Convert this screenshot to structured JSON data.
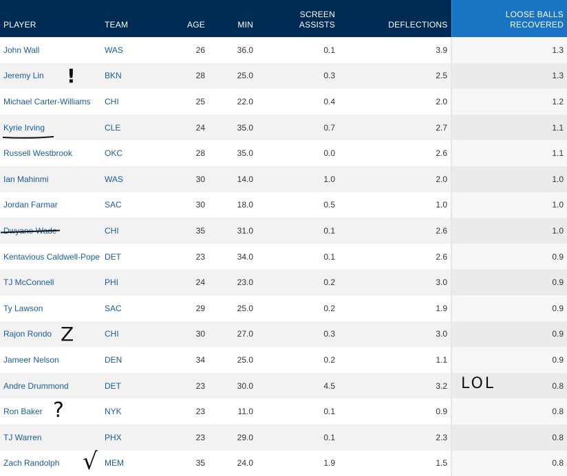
{
  "headers": {
    "player": "PLAYER",
    "team": "TEAM",
    "age": "AGE",
    "min": "MIN",
    "screen_assists_line1": "SCREEN",
    "screen_assists_line2": "ASSISTS",
    "deflections": "DEFLECTIONS",
    "loose_balls_line1": "LOOSE BALLS",
    "loose_balls_line2": "RECOVERED"
  },
  "rows": [
    {
      "player": "John Wall",
      "team": "WAS",
      "age": "26",
      "min": "36.0",
      "screen_assists": "0.1",
      "deflections": "3.9",
      "loose_balls": "1.3"
    },
    {
      "player": "Jeremy Lin",
      "team": "BKN",
      "age": "28",
      "min": "25.0",
      "screen_assists": "0.3",
      "deflections": "2.5",
      "loose_balls": "1.3"
    },
    {
      "player": "Michael Carter-Williams",
      "team": "CHI",
      "age": "25",
      "min": "22.0",
      "screen_assists": "0.4",
      "deflections": "2.0",
      "loose_balls": "1.2"
    },
    {
      "player": "Kyrie Irving",
      "team": "CLE",
      "age": "24",
      "min": "35.0",
      "screen_assists": "0.7",
      "deflections": "2.7",
      "loose_balls": "1.1"
    },
    {
      "player": "Russell Westbrook",
      "team": "OKC",
      "age": "28",
      "min": "35.0",
      "screen_assists": "0.0",
      "deflections": "2.6",
      "loose_balls": "1.1"
    },
    {
      "player": "Ian Mahinmi",
      "team": "WAS",
      "age": "30",
      "min": "14.0",
      "screen_assists": "1.0",
      "deflections": "2.0",
      "loose_balls": "1.0"
    },
    {
      "player": "Jordan Farmar",
      "team": "SAC",
      "age": "30",
      "min": "18.0",
      "screen_assists": "0.5",
      "deflections": "1.0",
      "loose_balls": "1.0"
    },
    {
      "player": "Dwyane Wade",
      "team": "CHI",
      "age": "35",
      "min": "31.0",
      "screen_assists": "0.1",
      "deflections": "2.6",
      "loose_balls": "1.0"
    },
    {
      "player": "Kentavious Caldwell-Pope",
      "team": "DET",
      "age": "23",
      "min": "34.0",
      "screen_assists": "0.1",
      "deflections": "2.6",
      "loose_balls": "0.9"
    },
    {
      "player": "TJ McConnell",
      "team": "PHI",
      "age": "24",
      "min": "23.0",
      "screen_assists": "0.2",
      "deflections": "3.0",
      "loose_balls": "0.9"
    },
    {
      "player": "Ty Lawson",
      "team": "SAC",
      "age": "29",
      "min": "25.0",
      "screen_assists": "0.2",
      "deflections": "1.9",
      "loose_balls": "0.9"
    },
    {
      "player": "Rajon Rondo",
      "team": "CHI",
      "age": "30",
      "min": "27.0",
      "screen_assists": "0.3",
      "deflections": "3.0",
      "loose_balls": "0.9"
    },
    {
      "player": "Jameer Nelson",
      "team": "DEN",
      "age": "34",
      "min": "25.0",
      "screen_assists": "0.2",
      "deflections": "1.1",
      "loose_balls": "0.9"
    },
    {
      "player": "Andre Drummond",
      "team": "DET",
      "age": "23",
      "min": "30.0",
      "screen_assists": "4.5",
      "deflections": "3.2",
      "loose_balls": "0.8"
    },
    {
      "player": "Ron Baker",
      "team": "NYK",
      "age": "23",
      "min": "11.0",
      "screen_assists": "0.1",
      "deflections": "0.9",
      "loose_balls": "0.8"
    },
    {
      "player": "TJ Warren",
      "team": "PHX",
      "age": "23",
      "min": "29.0",
      "screen_assists": "0.1",
      "deflections": "2.3",
      "loose_balls": "0.8"
    },
    {
      "player": "Zach Randolph",
      "team": "MEM",
      "age": "35",
      "min": "24.0",
      "screen_assists": "1.9",
      "deflections": "1.5",
      "loose_balls": "0.8"
    }
  ],
  "annotations": {
    "exclaim": "!",
    "zee": "Z",
    "lol": "LOL",
    "question": "?",
    "check": "√"
  },
  "colors": {
    "header_bg": "#002b55",
    "sorted_header_bg": "#1a74c4",
    "link": "#1a5c9e"
  }
}
